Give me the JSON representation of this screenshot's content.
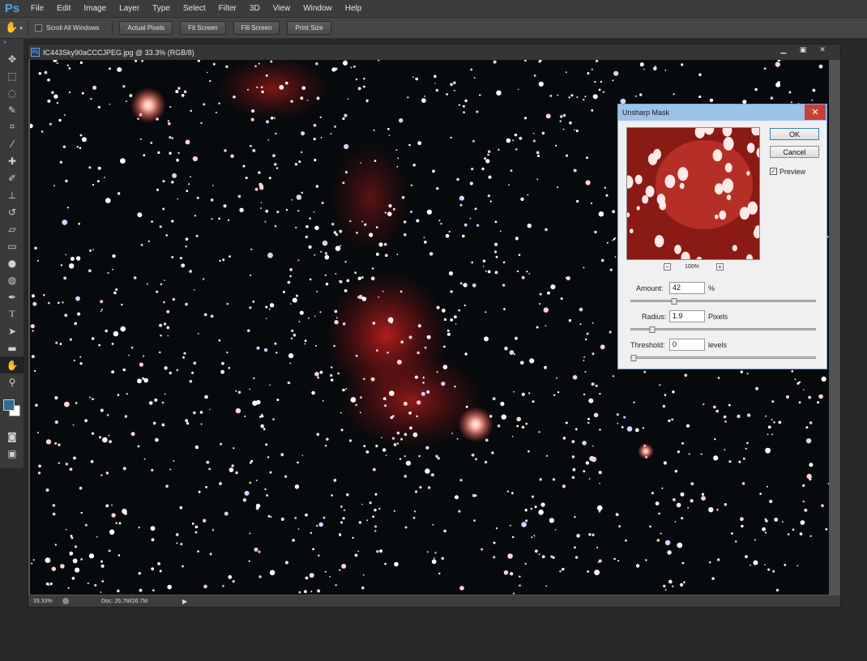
{
  "app": {
    "logo": "Ps"
  },
  "menu": [
    "File",
    "Edit",
    "Image",
    "Layer",
    "Type",
    "Select",
    "Filter",
    "3D",
    "View",
    "Window",
    "Help"
  ],
  "options": {
    "scroll_all_windows": "Scroll All Windows",
    "scroll_all_checked": false,
    "buttons": [
      "Actual Pixels",
      "Fit Screen",
      "Fill Screen",
      "Print Size"
    ]
  },
  "document": {
    "tab_title": "IC443Sky90aCCCJPEG.jpg @ 33.3% (RGB/8)",
    "zoom": "33.33%",
    "doc_info": "Doc: 26.7M/26.7M"
  },
  "dialog": {
    "title": "Unsharp Mask",
    "ok": "OK",
    "cancel": "Cancel",
    "preview_label": "Preview",
    "preview_checked": true,
    "preview_zoom": "100%",
    "amount_label": "Amount:",
    "amount_value": "42",
    "amount_unit": "%",
    "radius_label": "Radius:",
    "radius_value": "1.9",
    "radius_unit": "Pixels",
    "threshold_label": "Threshold:",
    "threshold_value": "0",
    "threshold_unit": "levels",
    "amount_slider": 0.22,
    "radius_slider": 0.1,
    "threshold_slider": 0.0
  },
  "colors": {
    "foreground": "#2f6d8f",
    "background": "#ffffff",
    "accent": "#9cc2ea"
  }
}
